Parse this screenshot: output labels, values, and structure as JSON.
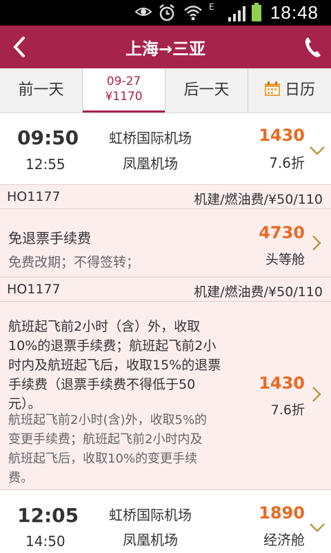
{
  "status_bar": {
    "time": "18:48",
    "network": "E"
  },
  "header": {
    "title": "上海→三亚"
  },
  "date_bar": {
    "prev": "前一天",
    "current_date": "09-27",
    "current_price": "¥1170",
    "next": "后一天",
    "calendar": "日历"
  },
  "flights": [
    {
      "dep_time": "09:50",
      "arr_time": "12:55",
      "dep_airport": "虹桥国际机场",
      "arr_airport": "凤凰机场",
      "price": "1430",
      "discount": "7.6折"
    },
    {
      "dep_time": "12:05",
      "arr_time": "14:50",
      "dep_airport": "虹桥国际机场",
      "arr_airport": "凤凰机场",
      "price": "1890",
      "discount": "经济舱"
    }
  ],
  "cabins": [
    {
      "flight_no": "HO1177",
      "tax": "机建/燃油费/¥50/110",
      "rule_title": "免退票手续费",
      "rule_detail": "免费改期；不得签转；",
      "price": "4730",
      "cabin": "头等舱"
    },
    {
      "flight_no": "HO1177",
      "tax": "机建/燃油费/¥50/110",
      "refund_lines": [
        "航班起飞前2小时（含）外，收取",
        "10%的退票手续费；航班起飞前2小",
        "时内及航班起飞后，收取15%的退票",
        "手续费（退票手续费不得低于50",
        "元）。"
      ],
      "change_lines": [
        "航班起飞前2小时(含)外，收取5%的",
        "变更手续费；航班起飞前2小时内及",
        "航班起飞后，收取10%的变更手续",
        "费。"
      ],
      "price": "1430",
      "discount": "7.6折"
    }
  ]
}
